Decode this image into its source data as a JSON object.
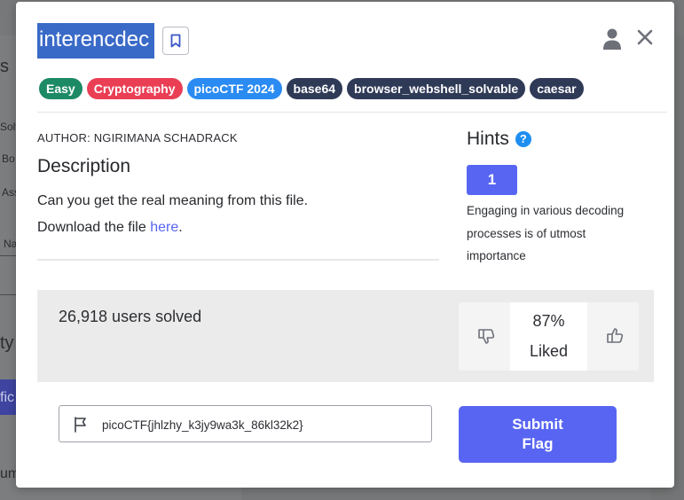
{
  "background": {
    "fragments": [
      "s",
      "Solv",
      "Bo",
      "Ass",
      "Na",
      "ty",
      "fic",
      "um"
    ]
  },
  "challenge": {
    "title": "interencdec",
    "tags": [
      {
        "label": "Easy",
        "color": "#1d8a66"
      },
      {
        "label": "Cryptography",
        "color": "#ea3e55"
      },
      {
        "label": "picoCTF 2024",
        "color": "#2a8bf2"
      },
      {
        "label": "base64",
        "color": "#2f3a57"
      },
      {
        "label": "browser_webshell_solvable",
        "color": "#2f3a57"
      },
      {
        "label": "caesar",
        "color": "#2f3a57"
      }
    ],
    "author": "AUTHOR: NGIRIMANA SCHADRACK",
    "description_heading": "Description",
    "description_line1": "Can you get the real meaning from this file.",
    "description_line2_prefix": "Download the file ",
    "description_link": "here",
    "description_line2_suffix": "."
  },
  "hints": {
    "heading": "Hints",
    "help_glyph": "?",
    "button_label": "1",
    "text": "Engaging in various decoding processes is of utmost importance"
  },
  "stats": {
    "solved": "26,918 users solved",
    "liked_percent": "87%",
    "liked_label": "Liked"
  },
  "flag": {
    "value": "picoCTF{jhlzhy_k3jy9wa3k_86kl32k2}",
    "submit_label": "Submit Flag"
  },
  "icons": {
    "bookmark": "bookmark-icon",
    "user": "user-icon",
    "close": "close-icon",
    "dislike": "thumbs-down-icon",
    "like": "thumbs-up-icon",
    "flag": "flag-icon",
    "help": "question-icon"
  },
  "colors": {
    "accent": "#5865f2",
    "title_highlight": "#3a6ac8"
  }
}
